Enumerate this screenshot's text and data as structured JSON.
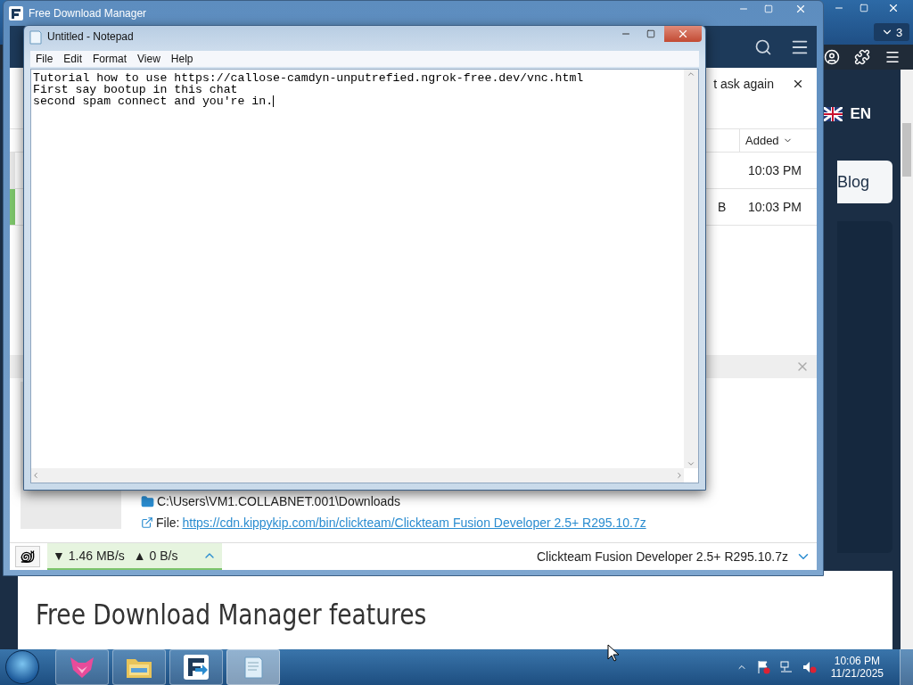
{
  "browser": {
    "tab_count": "3",
    "language": "EN",
    "nav_item": "Blog",
    "heading": "Free Download Manager features"
  },
  "fdm": {
    "title": "Free Download Manager",
    "notice": "t ask again",
    "column": "Added",
    "rows": [
      {
        "added": "10:03 PM",
        "selected": false
      },
      {
        "size": "B",
        "added": "10:03 PM",
        "selected": true
      }
    ],
    "folder": "C:\\Users\\VM1.COLLABNET.001\\Downloads",
    "file_label": "File:",
    "file_url": "https://cdn.kippykip.com/bin/clickteam/Clickteam Fusion Developer 2.5+ R295.10.7z",
    "down_speed": "▼ 1.46 MB/s",
    "up_speed": "▲ 0 B/s",
    "current_file": "Clickteam Fusion Developer 2.5+ R295.10.7z"
  },
  "notepad": {
    "title": "Untitled - Notepad",
    "menu": [
      "File",
      "Edit",
      "Format",
      "View",
      "Help"
    ],
    "lines": [
      "Tutorial how to use https://callose-camdyn-unputrefied.ngrok-free.dev/vnc.html",
      "First say bootup in this chat",
      "second spam connect and you're in."
    ]
  },
  "taskbar": {
    "apps": [
      {
        "kind": "fox",
        "selected": false
      },
      {
        "kind": "folder",
        "selected": false
      },
      {
        "kind": "fdm",
        "selected": false
      },
      {
        "kind": "notepad",
        "selected": true
      }
    ],
    "time": "10:06 PM",
    "date": "11/21/2025"
  }
}
